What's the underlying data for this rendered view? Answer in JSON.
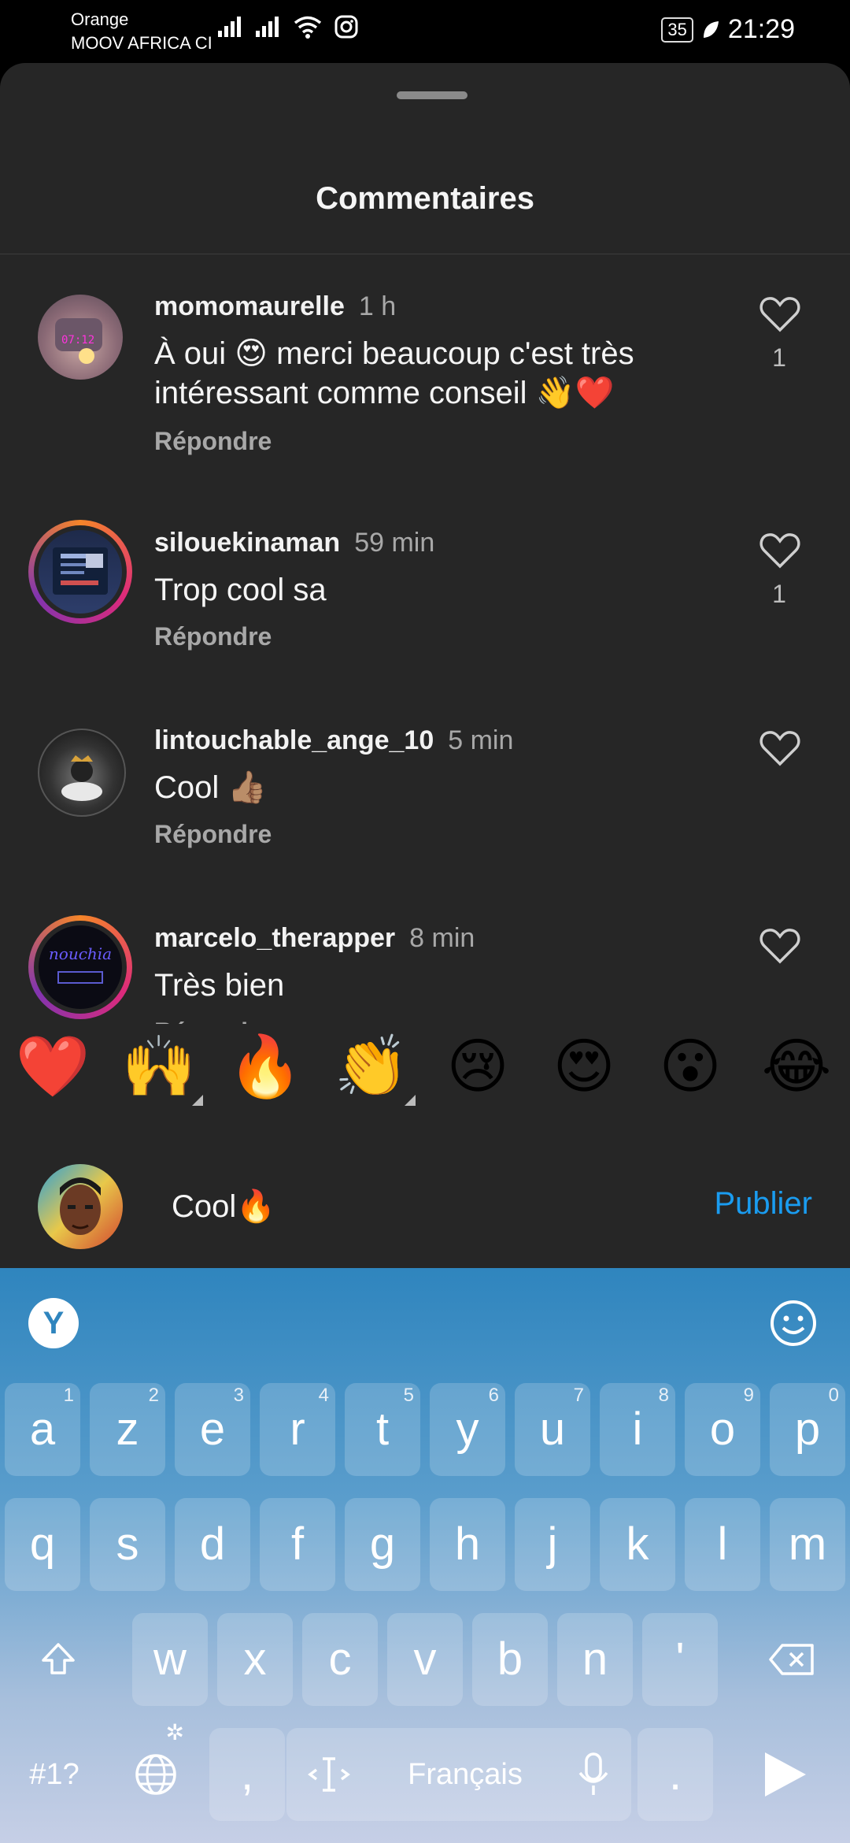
{
  "status_bar": {
    "carrier_1": "Orange",
    "carrier_2": "MOOV AFRICA CI",
    "battery": "35",
    "time": "21:29"
  },
  "sheet": {
    "title": "Commentaires"
  },
  "comments": [
    {
      "username": "momomaurelle",
      "time": "1 h",
      "text": "À oui 😍 merci beaucoup c'est très intéressant comme conseil 👋❤️",
      "reply_label": "Répondre",
      "likes": "1"
    },
    {
      "username": "silouekinaman",
      "time": "59 min",
      "text": "Trop cool sa",
      "reply_label": "Répondre",
      "likes": "1"
    },
    {
      "username": "lintouchable_ange_10",
      "time": "5 min",
      "text": "Cool 👍🏽",
      "reply_label": "Répondre",
      "likes": ""
    },
    {
      "username": "marcelo_therapper",
      "time": "8 min",
      "text": "Très bien",
      "reply_label": "Répondre",
      "likes": ""
    }
  ],
  "avatar_text": {
    "marcelo": "nouchia"
  },
  "emoji_bar": [
    "❤️",
    "🙌",
    "🔥",
    "👏",
    "😢",
    "😍",
    "😮",
    "😂"
  ],
  "composer": {
    "value": "Cool🔥",
    "publish_label": "Publier"
  },
  "keyboard": {
    "logo": "Y",
    "row1": [
      {
        "k": "a",
        "n": "1"
      },
      {
        "k": "z",
        "n": "2"
      },
      {
        "k": "e",
        "n": "3"
      },
      {
        "k": "r",
        "n": "4"
      },
      {
        "k": "t",
        "n": "5"
      },
      {
        "k": "y",
        "n": "6"
      },
      {
        "k": "u",
        "n": "7"
      },
      {
        "k": "i",
        "n": "8"
      },
      {
        "k": "o",
        "n": "9"
      },
      {
        "k": "p",
        "n": "0"
      }
    ],
    "row2": [
      "q",
      "s",
      "d",
      "f",
      "g",
      "h",
      "j",
      "k",
      "l",
      "m"
    ],
    "row3": [
      "w",
      "x",
      "c",
      "v",
      "b",
      "n",
      "'"
    ],
    "symbols_label": "#1?",
    "comma": ",",
    "space_label": "Français",
    "period": "."
  },
  "colors": {
    "sheet_bg": "#262626",
    "publish": "#1a9cf0",
    "heart_red": "#e53935"
  }
}
